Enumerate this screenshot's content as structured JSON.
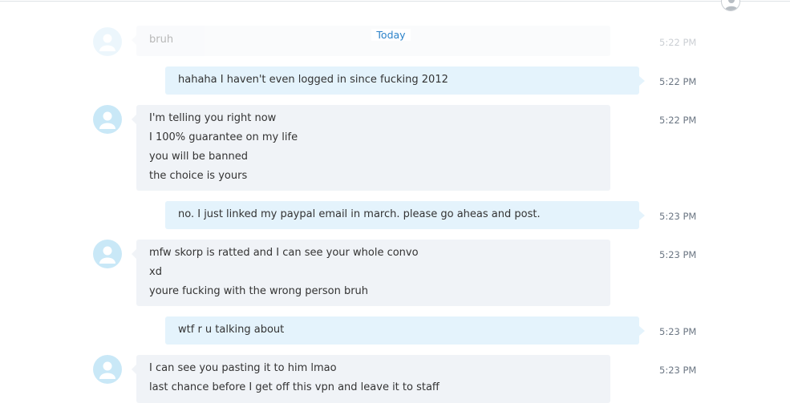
{
  "header": {
    "date_separator": "Today"
  },
  "messages": [
    {
      "direction": "incoming",
      "lines": [
        "bruh"
      ],
      "time": "5:22 PM"
    },
    {
      "direction": "outgoing",
      "lines": [
        "hahaha I haven't even logged in since fucking 2012"
      ],
      "time": "5:22 PM"
    },
    {
      "direction": "incoming",
      "lines": [
        "I'm telling you right now",
        "I 100% guarantee on my life",
        "you will be banned",
        "the choice is yours"
      ],
      "time": "5:22 PM"
    },
    {
      "direction": "outgoing",
      "lines": [
        "no. I just linked my paypal email in march. please go aheas and post."
      ],
      "time": "5:23 PM"
    },
    {
      "direction": "incoming",
      "lines": [
        "mfw skorp is ratted and I can see your whole convo",
        "xd",
        "youre fucking with the wrong person bruh"
      ],
      "time": "5:23 PM"
    },
    {
      "direction": "outgoing",
      "lines": [
        "wtf r u talking about"
      ],
      "time": "5:23 PM"
    },
    {
      "direction": "incoming",
      "lines": [
        "I can see you pasting it to him lmao",
        "last chance before I get off this vpn and leave it to staff"
      ],
      "time": "5:23 PM"
    }
  ]
}
